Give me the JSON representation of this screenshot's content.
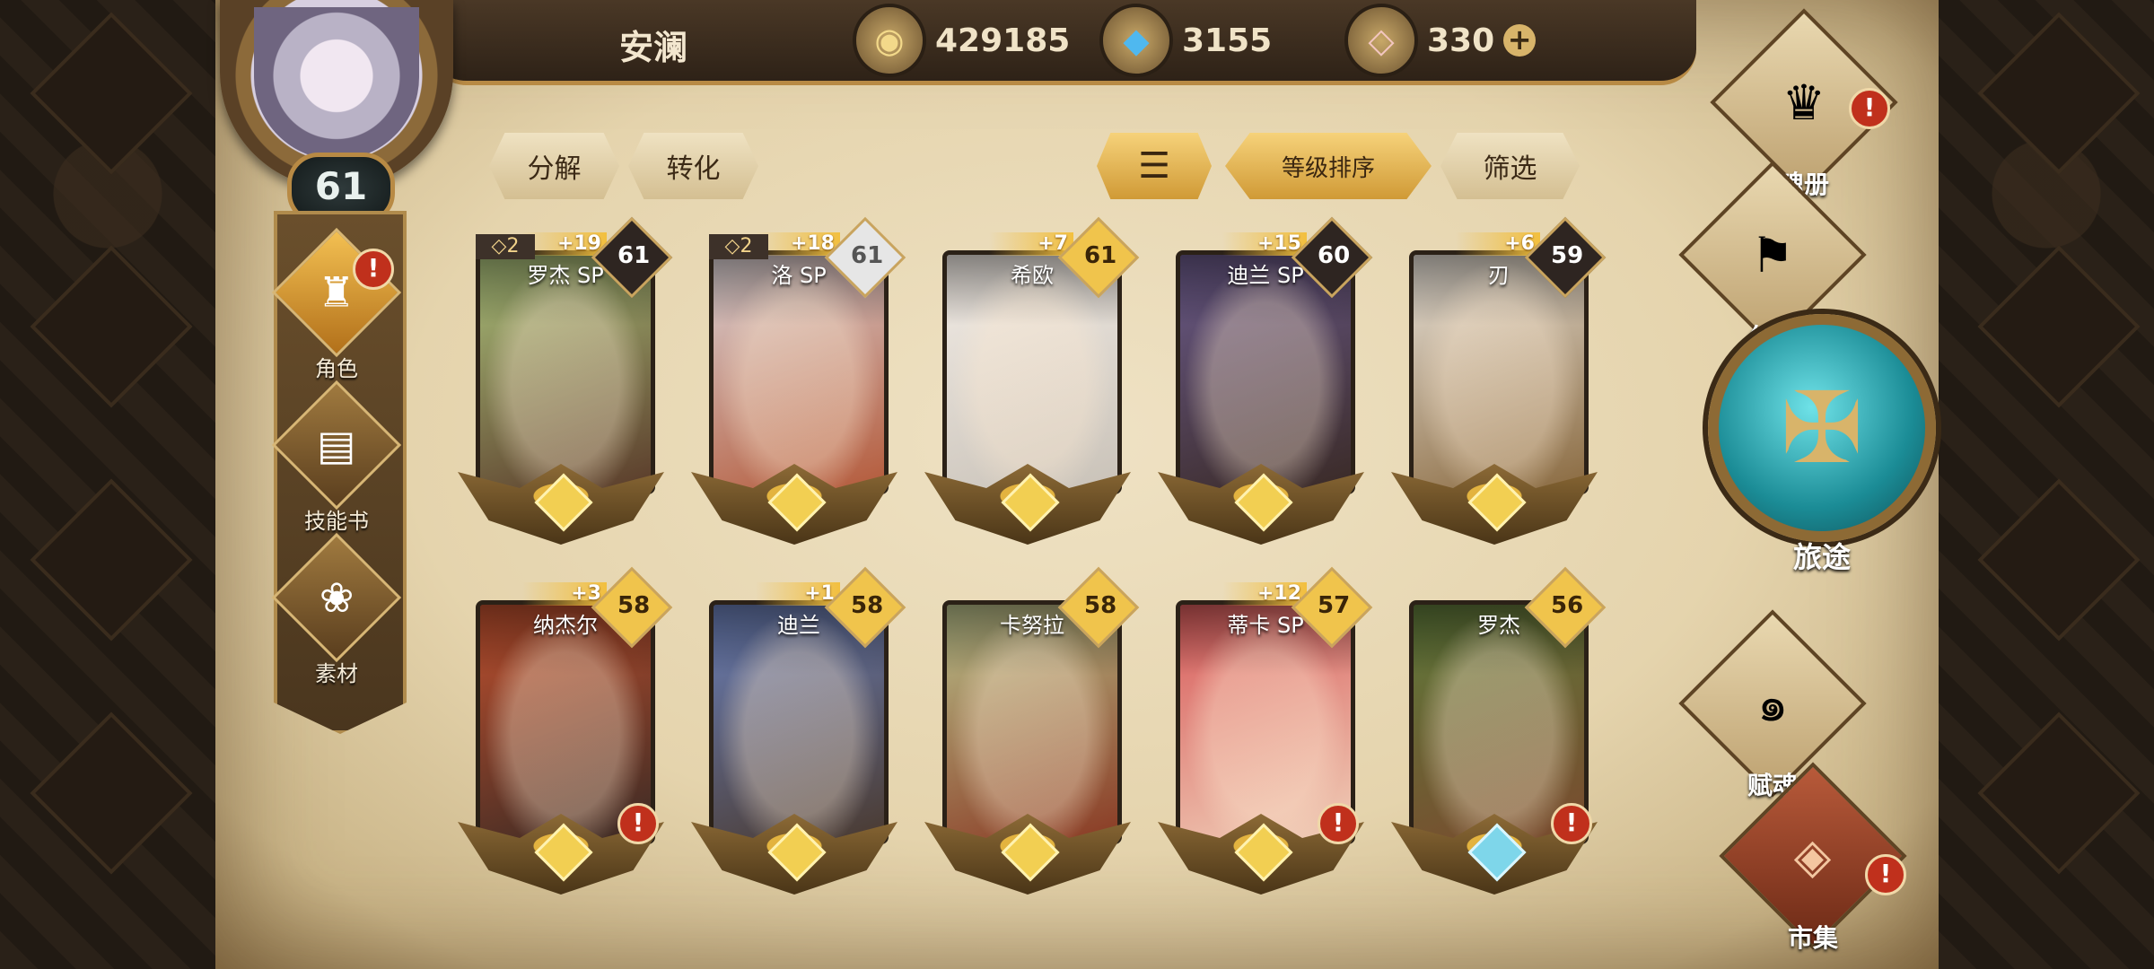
{
  "player": {
    "name": "安澜",
    "level": "61"
  },
  "currencies": [
    {
      "icon": "gold-coin-icon",
      "glyph": "◉",
      "value": "429185"
    },
    {
      "icon": "blue-crystal-icon",
      "glyph": "◆",
      "value": "3155"
    },
    {
      "icon": "pink-gem-icon",
      "glyph": "◇",
      "value": "330",
      "has_plus": true
    }
  ],
  "left_nav": [
    {
      "label": "角色",
      "icon": "character-icon",
      "glyph": "♜",
      "active": true,
      "alert": true
    },
    {
      "label": "技能书",
      "icon": "skill-book-icon",
      "glyph": "▤",
      "active": false,
      "alert": false
    },
    {
      "label": "素材",
      "icon": "material-icon",
      "glyph": "❀",
      "active": false,
      "alert": false
    }
  ],
  "toolbar": {
    "decompose": "分解",
    "convert": "转化",
    "sort_icon": "sort-lines-icon",
    "sort_by_level": "等级排序",
    "filter": "筛选"
  },
  "heroes": [
    {
      "name": "罗杰 SP",
      "level": "61",
      "bonus": "+19",
      "stars": "◇2",
      "level_style": "dark",
      "gem": "gold",
      "alert": false,
      "tone": [
        "#a9c07a",
        "#5a3b2a"
      ]
    },
    {
      "name": "洛 SP",
      "level": "61",
      "bonus": "+18",
      "stars": "◇2",
      "level_style": "silver",
      "gem": "gold",
      "alert": false,
      "tone": [
        "#d9d1d4",
        "#b45a3a"
      ]
    },
    {
      "name": "希欧",
      "level": "61",
      "bonus": "+7",
      "stars": "",
      "level_style": "gold",
      "gem": "gold",
      "alert": false,
      "tone": [
        "#f2ece6",
        "#c9c2b8"
      ]
    },
    {
      "name": "迪兰 SP",
      "level": "60",
      "bonus": "+15",
      "stars": "",
      "level_style": "dark",
      "gem": "gold",
      "alert": false,
      "tone": [
        "#6a5a8a",
        "#3a2a26"
      ]
    },
    {
      "name": "刃",
      "level": "59",
      "bonus": "+6",
      "stars": "",
      "level_style": "dark",
      "gem": "gold",
      "alert": false,
      "tone": [
        "#e7e1d8",
        "#8a6a40"
      ]
    },
    {
      "name": "纳杰尔",
      "level": "58",
      "bonus": "+3",
      "stars": "",
      "level_style": "gold",
      "gem": "gold",
      "alert": true,
      "tone": [
        "#c0502e",
        "#3a2a24"
      ]
    },
    {
      "name": "迪兰",
      "level": "58",
      "bonus": "+1",
      "stars": "",
      "level_style": "gold",
      "gem": "gold",
      "alert": false,
      "tone": [
        "#6a7fb8",
        "#4a3a30"
      ]
    },
    {
      "name": "卡努拉",
      "level": "58",
      "bonus": "",
      "stars": "",
      "level_style": "gold",
      "gem": "gold",
      "alert": false,
      "tone": [
        "#b8c08a",
        "#8a3a24"
      ]
    },
    {
      "name": "蒂卡 SP",
      "level": "57",
      "bonus": "+12",
      "stars": "",
      "level_style": "gold",
      "gem": "gold",
      "alert": true,
      "tone": [
        "#d85a5a",
        "#f0cfb8"
      ]
    },
    {
      "name": "罗杰",
      "level": "56",
      "bonus": "",
      "stars": "",
      "level_style": "gold",
      "gem": "blue",
      "alert": true,
      "tone": [
        "#5e7a3a",
        "#7a4a2e"
      ]
    }
  ],
  "right_nav": [
    {
      "label": "魂册",
      "icon": "soul-book-icon",
      "glyph": "♛",
      "alert": true,
      "red": false
    },
    {
      "label": "公会",
      "icon": "guild-icon",
      "glyph": "⚑",
      "alert": false,
      "red": false
    },
    {
      "label": "赋魂",
      "icon": "soul-infuse-icon",
      "glyph": "๑",
      "alert": false,
      "red": false
    },
    {
      "label": "市集",
      "icon": "market-icon",
      "glyph": "◈",
      "alert": true,
      "red": true
    }
  ],
  "journey": {
    "label": "旅途",
    "icon": "journey-emblem-icon",
    "glyph": "✠"
  },
  "alert_glyph": "!"
}
